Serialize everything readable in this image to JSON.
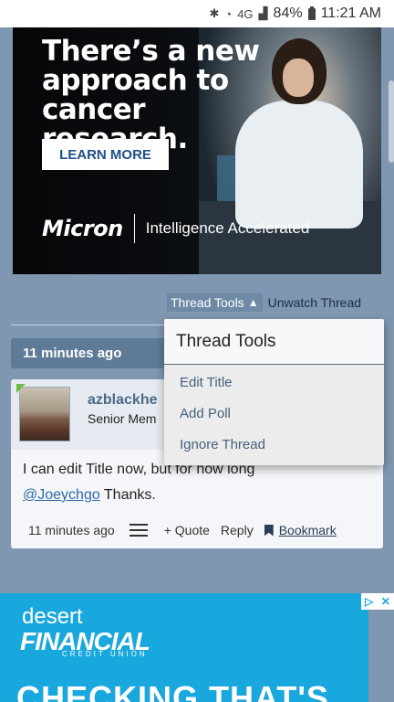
{
  "status_bar": {
    "bluetooth_icon": "bluetooth-icon",
    "wifi_icon": "wifi-icon",
    "network_label": "4G",
    "battery": "84%",
    "time": "11:21 AM"
  },
  "ad_top": {
    "headline": "There’s a new approach to cancer research.",
    "cta": "LEARN MORE",
    "brand": "Micron",
    "tagline": "Intelligence Accelerated"
  },
  "thread_bar": {
    "tools_label": "Thread Tools",
    "unwatch_label": "Unwatch Thread"
  },
  "post": {
    "timestamp": "11 minutes ago",
    "username": "azblackhe",
    "user_title": "Senior Mem",
    "body_line1": "I can edit Title now, but for how long",
    "mention": "@Joeychgo",
    "body_line2_rest": " Thanks.",
    "footer": {
      "time": "11 minutes ago",
      "quote": "+ Quote",
      "reply": "Reply",
      "bookmark": "Bookmark"
    }
  },
  "dropdown": {
    "title": "Thread Tools",
    "items": [
      "Edit Title",
      "Add Poll",
      "Ignore Thread"
    ]
  },
  "ad_bottom": {
    "brand_top": "desert",
    "brand_main": "FINANCIAL",
    "brand_sub": "CREDIT UNION",
    "headline": "CHECKING THAT'S"
  },
  "colors": {
    "page_bg": "#7f97b0",
    "accent_blue": "#5e7a97",
    "link": "#2f6aa7",
    "ad_bottom_bg": "#19a8dd"
  }
}
